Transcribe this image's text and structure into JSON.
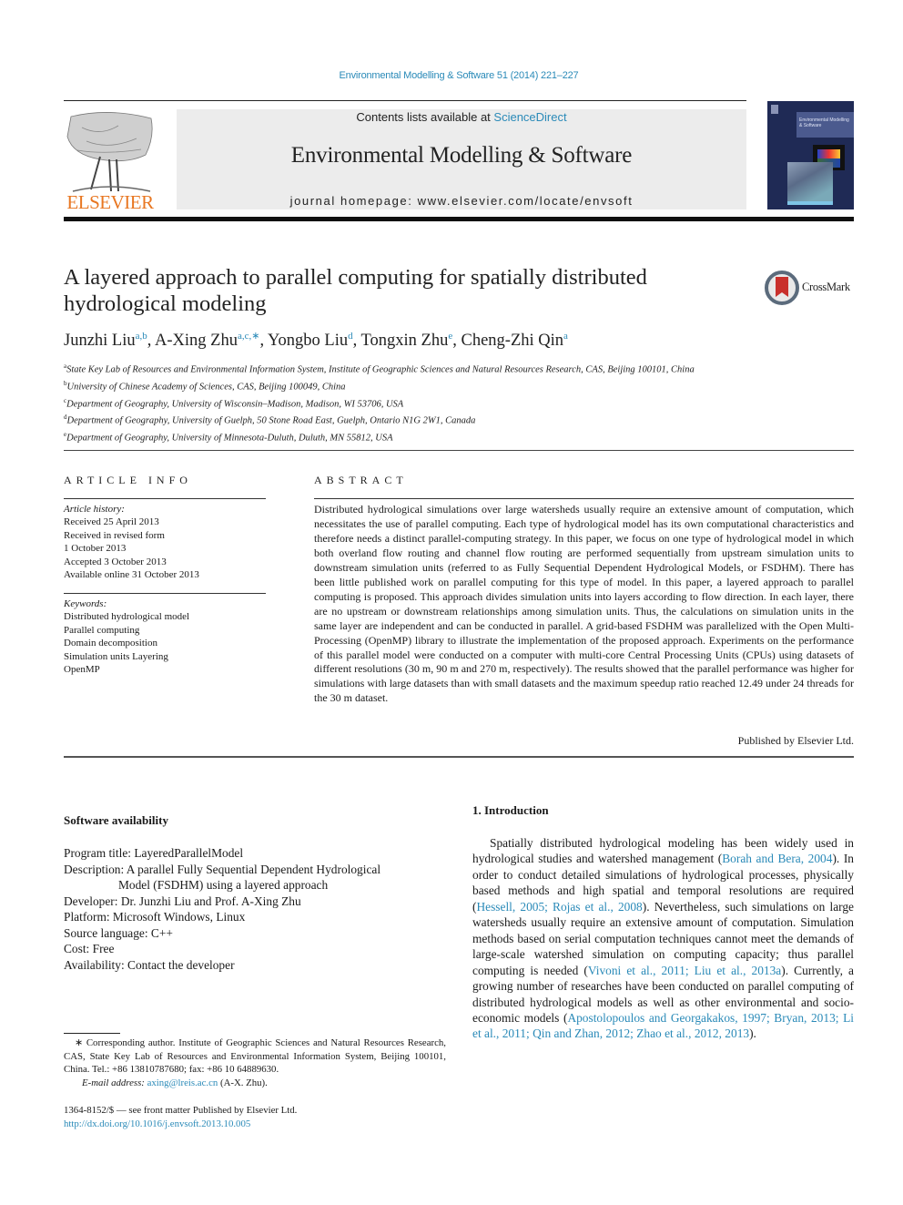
{
  "header": {
    "journal_ref": "Environmental Modelling & Software 51 (2014) 221–227",
    "contents_prefix": "Contents lists available at ",
    "contents_link": "ScienceDirect",
    "journal_title": "Environmental Modelling & Software",
    "homepage": "journal homepage: www.elsevier.com/locate/envsoft",
    "publisher_logo_text": "ELSEVIER",
    "cover_title": "Environmental Modelling & Software",
    "crossmark_label": "CrossMark"
  },
  "colors": {
    "link": "#2a8ab8",
    "elsevier_orange": "#e87722",
    "banner_bg": "#ececec",
    "cover_bg": "#1f2a55"
  },
  "article": {
    "title": "A layered approach to parallel computing for spatially distributed hydrological modeling",
    "authors": [
      {
        "name": "Junzhi Liu",
        "sup": "a,b",
        "sep": ", "
      },
      {
        "name": "A-Xing Zhu",
        "sup": "a,c,∗",
        "sep": ", "
      },
      {
        "name": "Yongbo Liu",
        "sup": "d",
        "sep": ", "
      },
      {
        "name": "Tongxin Zhu",
        "sup": "e",
        "sep": ", "
      },
      {
        "name": "Cheng-Zhi Qin",
        "sup": "a",
        "sep": ""
      }
    ],
    "affiliations": [
      {
        "key": "a",
        "text": "State Key Lab of Resources and Environmental Information System, Institute of Geographic Sciences and Natural Resources Research, CAS, Beijing 100101, China"
      },
      {
        "key": "b",
        "text": "University of Chinese Academy of Sciences, CAS, Beijing 100049, China"
      },
      {
        "key": "c",
        "text": "Department of Geography, University of Wisconsin–Madison, Madison, WI 53706, USA"
      },
      {
        "key": "d",
        "text": "Department of Geography, University of Guelph, 50 Stone Road East, Guelph, Ontario N1G 2W1, Canada"
      },
      {
        "key": "e",
        "text": "Department of Geography, University of Minnesota-Duluth, Duluth, MN 55812, USA"
      }
    ]
  },
  "article_info": {
    "heading": "ARTICLE INFO",
    "history_label": "Article history:",
    "history": [
      "Received 25 April 2013",
      "Received in revised form",
      "1 October 2013",
      "Accepted 3 October 2013",
      "Available online 31 October 2013"
    ],
    "keywords_label": "Keywords:",
    "keywords": [
      "Distributed hydrological model",
      "Parallel computing",
      "Domain decomposition",
      "Simulation units Layering",
      "OpenMP"
    ]
  },
  "abstract": {
    "heading": "ABSTRACT",
    "text": "Distributed hydrological simulations over large watersheds usually require an extensive amount of computation, which necessitates the use of parallel computing. Each type of hydrological model has its own computational characteristics and therefore needs a distinct parallel-computing strategy. In this paper, we focus on one type of hydrological model in which both overland flow routing and channel flow routing are performed sequentially from upstream simulation units to downstream simulation units (referred to as Fully Sequential Dependent Hydrological Models, or FSDHM). There has been little pub­lished work on parallel computing for this type of model. In this paper, a layered approach to parallel computing is proposed. This approach divides simulation units into layers according to flow direction. In each layer, there are no upstream or downstream relationships among simulation units. Thus, the cal­culations on simulation units in the same layer are independent and can be conducted in parallel. A grid-based FSDHM was parallelized with the Open Multi-Processing (OpenMP) library to illustrate the implementation of the proposed approach. Experiments on the performance of this parallel model were conducted on a computer with multi-core Central Processing Units (CPUs) using datasets of different resolutions (30 m, 90 m and 270 m, respectively). The results showed that the parallel performance was higher for simulations with large datasets than with small datasets and the maximum speedup ratio reached 12.49 under 24 threads for the 30 m dataset.",
    "published_by": "Published by Elsevier Ltd."
  },
  "software": {
    "heading": "Software availability",
    "program_title": "Program title: LayeredParallelModel",
    "description_1": "Description: A parallel Fully Sequential Dependent Hydrological",
    "description_2": "Model (FSDHM) using a layered approach",
    "developer": "Developer: Dr. Junzhi Liu and Prof. A-Xing Zhu",
    "platform": "Platform: Microsoft Windows, Linux",
    "language": "Source language: C++",
    "cost": "Cost: Free",
    "availability": "Availability: Contact the developer"
  },
  "footnote": {
    "corresponding": "∗ Corresponding author. Institute of Geographic Sciences and Natural Resources Research, CAS, State Key Lab of Resources and Environmental Information System, Beijing 100101, China. Tel.: +86 13810787680; fax: +86 10 64889630.",
    "email_label": "E-mail address: ",
    "email": "axing@lreis.ac.cn",
    "email_suffix": " (A-X. Zhu).",
    "issn": "1364-8152/$ — see front matter Published by Elsevier Ltd.",
    "doi": "http://dx.doi.org/10.1016/j.envsoft.2013.10.005"
  },
  "introduction": {
    "heading": "1.  Introduction",
    "segments": [
      {
        "t": "Spatially distributed hydrological modeling has been widely used in hydrological studies and watershed management ("
      },
      {
        "t": "Borah and Bera, 2004",
        "link": true
      },
      {
        "t": "). In order to conduct detailed simulations of hydrological processes, physically based methods and high spatial and temporal resolutions are required ("
      },
      {
        "t": "Hessell, 2005; Rojas et al., 2008",
        "link": true
      },
      {
        "t": "). Nevertheless, such simulations on large wa­tersheds usually require an extensive amount of computation. Simulation methods based on serial computation techniques cannot meet the demands of large-scale watershed simulation on computing capacity; thus parallel computing is needed ("
      },
      {
        "t": "Vivoni et al., 2011; Liu et al., 2013a",
        "link": true
      },
      {
        "t": "). Currently, a growing number of researches have been conducted on parallel computing of distributed hydrological models as well as other environmental and socio-economic models ("
      },
      {
        "t": "Apostolopoulos and Georgakakos, 1997; Bryan, 2013; Li et al., 2011; Qin and Zhan, 2012; Zhao et al., 2012, 2013",
        "link": true
      },
      {
        "t": ")."
      }
    ]
  }
}
